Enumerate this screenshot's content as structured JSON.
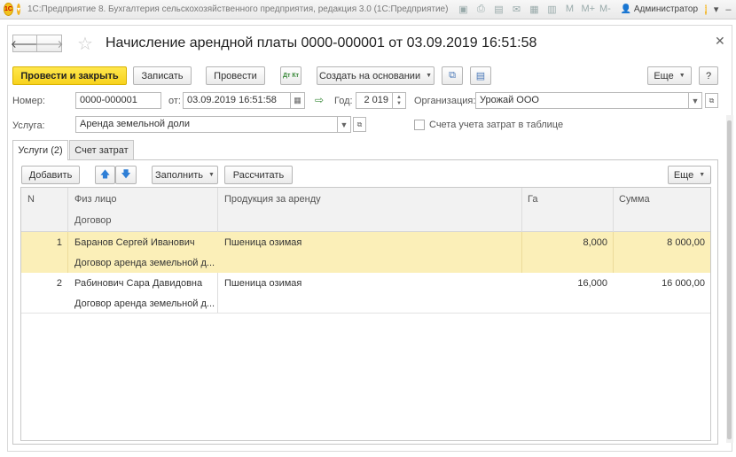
{
  "titlebar": {
    "logo": "1С",
    "title": "1С:Предприятие 8. Бухгалтерия сельскохозяйственного предприятия, редакция 3.0  (1С:Предприятие)",
    "icons": [
      "save-icon",
      "print-icon",
      "preview-icon",
      "mail-icon",
      "table-icon",
      "calendar-icon",
      "M",
      "M+",
      "M-"
    ],
    "user": "Администратор"
  },
  "header": {
    "title": "Начисление арендной платы 0000-000001 от 03.09.2019 16:51:58"
  },
  "toolbar": {
    "post_close": "Провести и закрыть",
    "save": "Записать",
    "post": "Провести",
    "dtkt": "Дт Кт",
    "create_based": "Создать на основании",
    "more": "Еще",
    "help": "?"
  },
  "form": {
    "number_label": "Номер:",
    "number_value": "0000-000001",
    "date_label": "от:",
    "date_value": "03.09.2019 16:51:58",
    "year_label": "Год:",
    "year_value": "2 019",
    "org_label": "Организация:",
    "org_value": "Урожай ООО",
    "service_label": "Услуга:",
    "service_value": "Аренда земельной доли",
    "cost_accounts_label": "Счета учета затрат в таблице"
  },
  "tabs": [
    {
      "label": "Услуги (2)",
      "active": true
    },
    {
      "label": "Счет затрат",
      "active": false
    }
  ],
  "table_toolbar": {
    "add": "Добавить",
    "fill": "Заполнить",
    "calc": "Рассчитать",
    "more": "Еще"
  },
  "table": {
    "headers": {
      "n": "N",
      "person": "Физ лицо",
      "contract": "Договор",
      "product": "Продукция за аренду",
      "ha": "Га",
      "sum": "Сумма"
    },
    "rows": [
      {
        "n": "1",
        "person": "Баранов Сергей Иванович",
        "contract": "Договор аренда земельной д...",
        "product": "Пшеница озимая",
        "ha": "8,000",
        "sum": "8 000,00"
      },
      {
        "n": "2",
        "person": "Рабинович Сара Давидовна",
        "contract": "Договор аренда земельной д...",
        "product": "Пшеница озимая",
        "ha": "16,000",
        "sum": "16 000,00"
      }
    ]
  }
}
